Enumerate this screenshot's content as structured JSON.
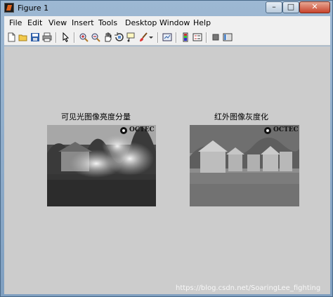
{
  "window": {
    "title": "Figure 1"
  },
  "menu": {
    "items": [
      "File",
      "Edit",
      "View",
      "Insert",
      "Tools",
      "Desktop",
      "Window",
      "Help"
    ]
  },
  "toolbar": {
    "tools": [
      "new-file-icon",
      "open-folder-icon",
      "save-icon",
      "print-icon",
      "select-arrow-icon",
      "zoom-in-icon",
      "zoom-out-icon",
      "pan-hand-icon",
      "rotate-3d-icon",
      "data-cursor-icon",
      "brush-icon",
      "link-plot-icon",
      "colorbar-icon",
      "legend-icon",
      "hide-plot-tools-icon",
      "show-plot-tools-icon"
    ]
  },
  "figure": {
    "left_axes": {
      "title": "可见光图像亮度分量",
      "logo_text": "OCTEC"
    },
    "right_axes": {
      "title": "红外图像灰度化",
      "logo_text": "OCTEC"
    }
  },
  "watermark": "https://blog.csdn.net/SoaringLee_fighting",
  "colors": {
    "figure_bg": "#cccccc",
    "menu_bg": "#f0f0f0",
    "title_bar": "#9db8d3",
    "close_button": "#c8432b"
  }
}
